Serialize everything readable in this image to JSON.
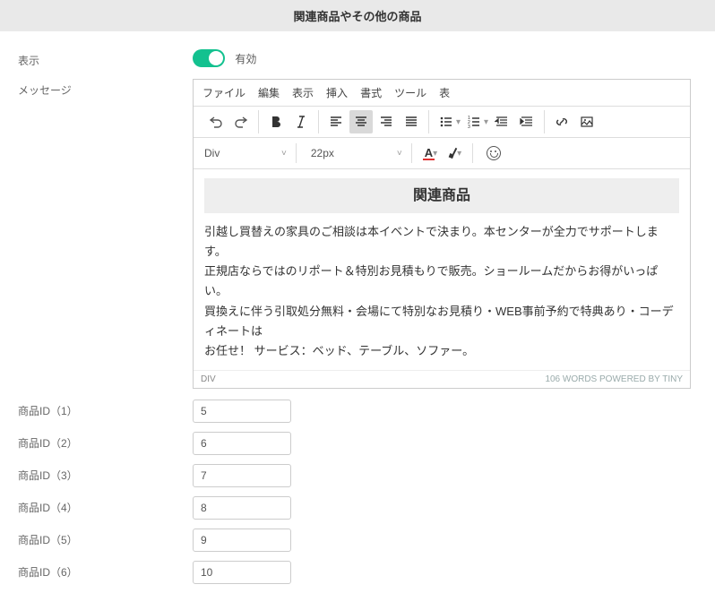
{
  "header": "関連商品やその他の商品",
  "display": {
    "label": "表示",
    "status": "有効"
  },
  "message_label": "メッセージ",
  "editor": {
    "menu": [
      "ファイル",
      "編集",
      "表示",
      "挿入",
      "書式",
      "ツール",
      "表"
    ],
    "format_select": "Div",
    "size_select": "22px",
    "content_title": "関連商品",
    "content_body": "引越し買替えの家具のご相談は本イベントで決まり。本センターが全力でサポートします。\n正規店ならではのリポート＆特別お見積もりで販売。ショールームだからお得がいっぱい。\n買換えに伴う引取処分無料・会場にて特別なお見積り・WEB事前予約で特典あり・コーディネートは\nお任せ！ サービス：ベッド、テーブル、ソファー。",
    "status_left": "DIV",
    "status_right": "106 WORDS POWERED BY TINY"
  },
  "products": [
    {
      "label": "商品ID（1）",
      "value": "5"
    },
    {
      "label": "商品ID（2）",
      "value": "6"
    },
    {
      "label": "商品ID（3）",
      "value": "7"
    },
    {
      "label": "商品ID（4）",
      "value": "8"
    },
    {
      "label": "商品ID（5）",
      "value": "9"
    },
    {
      "label": "商品ID（6）",
      "value": "10"
    }
  ]
}
